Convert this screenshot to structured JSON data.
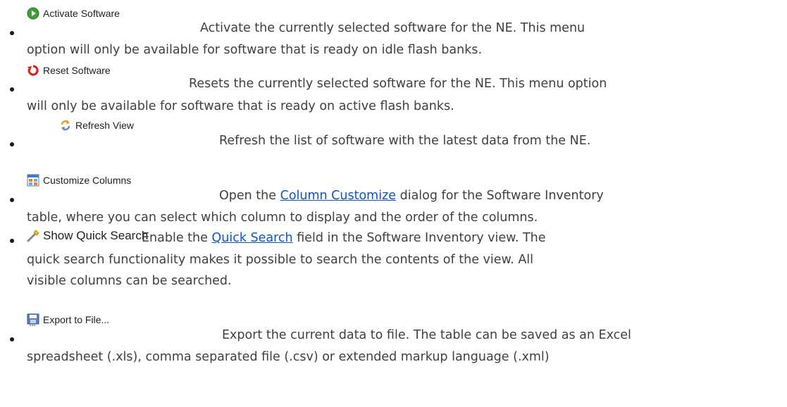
{
  "items": [
    {
      "menu_label": "Activate Software",
      "icon": "play-icon",
      "line1": "Activate the currently selected software for the NE. This menu",
      "line2": "option will only be available for software that is ready on idle flash banks."
    },
    {
      "menu_label": "Reset Software",
      "icon": "reset-icon",
      "line1": "Resets the currently selected software for the NE. This menu option",
      "line2": "will only be available for software that is ready on active flash banks."
    },
    {
      "menu_label": "Refresh View",
      "icon": "refresh-icon",
      "line1": "Refresh the list of software with the latest data from the NE."
    },
    {
      "menu_label": "Customize Columns",
      "icon": "columns-icon",
      "line1_before": "Open the ",
      "line1_link": "Column Customize",
      "line1_after": " dialog for the Software Inventory",
      "line2": "table, where you can select which column to display and the order of the columns."
    },
    {
      "menu_label": "Show Quick Search",
      "icon": "search-wand-icon",
      "line1_before": "Enable the ",
      "line1_link": "Quick Search",
      "line1_after": " field in the Software Inventory view. The",
      "line2": "quick search functionality makes it possible to search the contents of the view. All",
      "line3": "visible columns can be searched."
    },
    {
      "menu_label": "Export to File...",
      "icon": "save-icon",
      "line1": "Export the current data to file. The table can be saved as an Excel",
      "line2": "spreadsheet (.xls), comma separated file (.csv) or extended markup language (.xml)"
    }
  ]
}
